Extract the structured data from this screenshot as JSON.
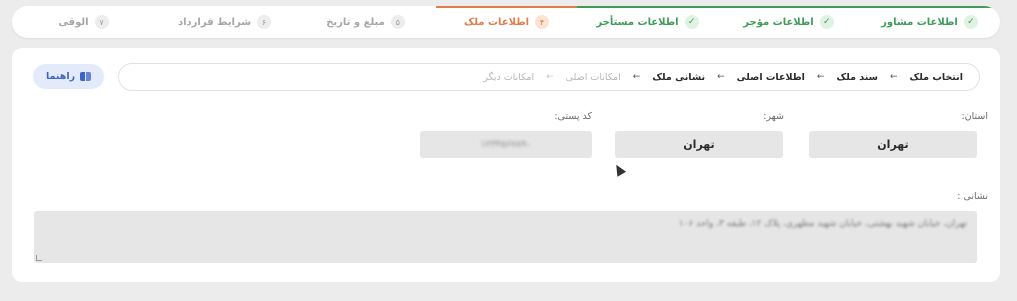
{
  "stepper": {
    "steps": [
      {
        "num": "✓",
        "label": "اطلاعات مشاور",
        "state": "done"
      },
      {
        "num": "✓",
        "label": "اطلاعات مؤجر",
        "state": "done"
      },
      {
        "num": "✓",
        "label": "اطلاعات مستأجر",
        "state": "done"
      },
      {
        "num": "۴",
        "label": "اطلاعات ملک",
        "state": "active"
      },
      {
        "num": "۵",
        "label": "مبلغ و تاریخ",
        "state": "pending"
      },
      {
        "num": "۶",
        "label": "شرایط قرارداد",
        "state": "pending"
      },
      {
        "num": "۷",
        "label": "الوقی",
        "state": "pending"
      }
    ]
  },
  "help": {
    "label": "راهنما",
    "icon": "book-icon"
  },
  "breadcrumb": {
    "items": [
      {
        "label": "انتخاب ملک",
        "dim": false
      },
      {
        "label": "سند ملک",
        "dim": false
      },
      {
        "label": "اطلاعات اصلی",
        "dim": false
      },
      {
        "label": "نشانی ملک",
        "dim": false
      },
      {
        "label": "امکانات اصلی",
        "dim": true
      },
      {
        "label": "امکانات دیگر",
        "dim": true
      }
    ],
    "arrow": "←"
  },
  "form": {
    "province_label": "استان:",
    "province_value": "تهران",
    "city_label": "شهر:",
    "city_value": "تهران",
    "postal_label": "کد پستی:",
    "postal_value": "۱۲۳۴۵۶۷۸۹۰",
    "address_label": "نشانی :",
    "address_value": "تهران، خیابان شهید بهشتی، خیابان شهید مطهری، پلاک ۱۲، طبقه ۳، واحد ۱۰۶"
  },
  "colors": {
    "done": "#3d9c59",
    "active": "#e27c48",
    "help": "#3e63c8"
  }
}
